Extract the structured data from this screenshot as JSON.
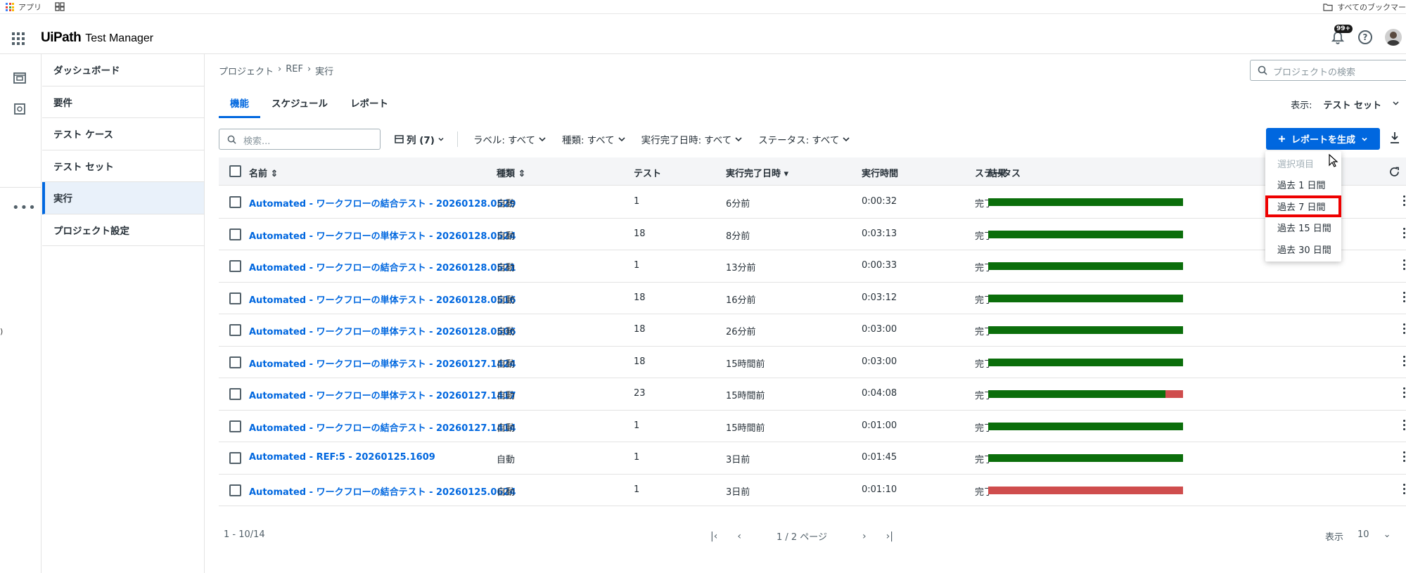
{
  "browser": {
    "apps_label": "アプリ",
    "bookmarks_label": "すべてのブックマー"
  },
  "header": {
    "logo_mark": "UiPath",
    "product": "Test Manager",
    "notif_badge": "99+",
    "help_glyph": "?"
  },
  "rail": {
    "more": "•••"
  },
  "sidebar": {
    "items": [
      {
        "label": "ダッシュボード"
      },
      {
        "label": "要件"
      },
      {
        "label": "テスト ケース"
      },
      {
        "label": "テスト セット"
      },
      {
        "label": "実行",
        "active": true
      },
      {
        "label": "プロジェクト設定"
      }
    ]
  },
  "breadcrumb": [
    "プロジェクト",
    "›",
    "REF",
    "›",
    "実行"
  ],
  "project_search": {
    "placeholder": "プロジェクトの検索"
  },
  "tabs": [
    {
      "label": "機能",
      "active": true
    },
    {
      "label": "スケジュール"
    },
    {
      "label": "レポート"
    }
  ],
  "view_selector": {
    "label": "表示:",
    "value": "テスト セット"
  },
  "filters": {
    "search_placeholder": "検索...",
    "columns": "列 (7)",
    "label": {
      "name": "ラベル:",
      "value": "すべて"
    },
    "type": {
      "name": "種類:",
      "value": "すべて"
    },
    "finished": {
      "name": "実行完了日時:",
      "value": "すべて"
    },
    "status": {
      "name": "ステータス:",
      "value": "すべて"
    }
  },
  "generate_button": {
    "label": "レポートを生成"
  },
  "table": {
    "columns": {
      "name": "名前 ⇕",
      "type": "種類 ⇕",
      "tests": "テスト",
      "finished": "実行完了日時 ▾",
      "duration": "実行時間",
      "status": "ステータス",
      "result": "結果"
    },
    "rows": [
      {
        "name": "Automated - ワークフローの結合テスト - 20260128.0529",
        "type": "自動",
        "tests": "1",
        "finished": "6分前",
        "duration": "0:00:32",
        "status": "完了",
        "pass": 1.0
      },
      {
        "name": "Automated - ワークフローの単体テスト - 20260128.0524",
        "type": "自動",
        "tests": "18",
        "finished": "8分前",
        "duration": "0:03:13",
        "status": "完了",
        "pass": 1.0
      },
      {
        "name": "Automated - ワークフローの結合テスト - 20260128.0521",
        "type": "自動",
        "tests": "1",
        "finished": "13分前",
        "duration": "0:00:33",
        "status": "完了",
        "pass": 1.0
      },
      {
        "name": "Automated - ワークフローの単体テスト - 20260128.0516",
        "type": "自動",
        "tests": "18",
        "finished": "16分前",
        "duration": "0:03:12",
        "status": "完了",
        "pass": 1.0
      },
      {
        "name": "Automated - ワークフローの単体テスト - 20260128.0506",
        "type": "自動",
        "tests": "18",
        "finished": "26分前",
        "duration": "0:03:00",
        "status": "完了",
        "pass": 1.0
      },
      {
        "name": "Automated - ワークフローの単体テスト - 20260127.1424",
        "type": "自動",
        "tests": "18",
        "finished": "15時間前",
        "duration": "0:03:00",
        "status": "完了",
        "pass": 1.0
      },
      {
        "name": "Automated - ワークフローの単体テスト - 20260127.1417",
        "type": "自動",
        "tests": "23",
        "finished": "15時間前",
        "duration": "0:04:08",
        "status": "完了",
        "pass": 0.91
      },
      {
        "name": "Automated - ワークフローの結合テスト - 20260127.1414",
        "type": "自動",
        "tests": "1",
        "finished": "15時間前",
        "duration": "0:01:00",
        "status": "完了",
        "pass": 1.0
      },
      {
        "name": "Automated - REF:5 - 20260125.1609",
        "type": "自動",
        "tests": "1",
        "finished": "3日前",
        "duration": "0:01:45",
        "status": "完了",
        "pass": 1.0
      },
      {
        "name": "Automated - ワークフローの結合テスト - 20260125.0624",
        "type": "自動",
        "tests": "1",
        "finished": "3日前",
        "duration": "0:01:10",
        "status": "完了",
        "pass": 0.0
      }
    ]
  },
  "footer": {
    "count": "1 - 10/14",
    "first": "|‹",
    "prev": "‹",
    "page": "1 / 2 ページ",
    "next": "›",
    "last": "›|",
    "size_label": "表示",
    "size_value": "10",
    "size_chevron": "⌄"
  },
  "menu": {
    "items": [
      {
        "label": "選択項目",
        "disabled": true
      },
      {
        "label": "過去 1 日間"
      },
      {
        "label": "過去 7 日間",
        "highlighted": true
      },
      {
        "label": "過去 15 日間"
      },
      {
        "label": "過去 30 日間"
      }
    ]
  },
  "colors": {
    "accent": "#0067df",
    "pass": "#0b6e0b",
    "fail": "#cf4d4d",
    "highlight": "#ee0000"
  },
  "edge_glyph": ")"
}
